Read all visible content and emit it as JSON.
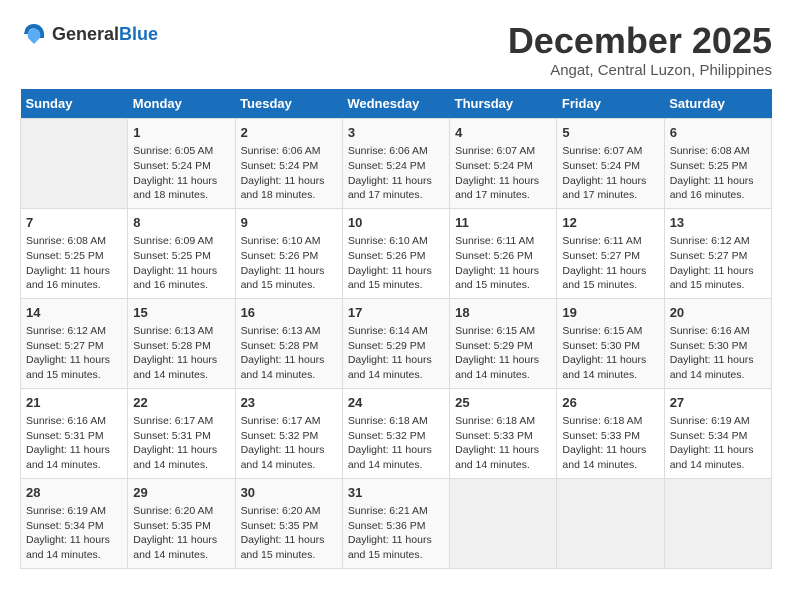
{
  "logo": {
    "general": "General",
    "blue": "Blue"
  },
  "title": "December 2025",
  "subtitle": "Angat, Central Luzon, Philippines",
  "days_header": [
    "Sunday",
    "Monday",
    "Tuesday",
    "Wednesday",
    "Thursday",
    "Friday",
    "Saturday"
  ],
  "weeks": [
    [
      {
        "num": "",
        "info": ""
      },
      {
        "num": "1",
        "info": "Sunrise: 6:05 AM\nSunset: 5:24 PM\nDaylight: 11 hours\nand 18 minutes."
      },
      {
        "num": "2",
        "info": "Sunrise: 6:06 AM\nSunset: 5:24 PM\nDaylight: 11 hours\nand 18 minutes."
      },
      {
        "num": "3",
        "info": "Sunrise: 6:06 AM\nSunset: 5:24 PM\nDaylight: 11 hours\nand 17 minutes."
      },
      {
        "num": "4",
        "info": "Sunrise: 6:07 AM\nSunset: 5:24 PM\nDaylight: 11 hours\nand 17 minutes."
      },
      {
        "num": "5",
        "info": "Sunrise: 6:07 AM\nSunset: 5:24 PM\nDaylight: 11 hours\nand 17 minutes."
      },
      {
        "num": "6",
        "info": "Sunrise: 6:08 AM\nSunset: 5:25 PM\nDaylight: 11 hours\nand 16 minutes."
      }
    ],
    [
      {
        "num": "7",
        "info": "Sunrise: 6:08 AM\nSunset: 5:25 PM\nDaylight: 11 hours\nand 16 minutes."
      },
      {
        "num": "8",
        "info": "Sunrise: 6:09 AM\nSunset: 5:25 PM\nDaylight: 11 hours\nand 16 minutes."
      },
      {
        "num": "9",
        "info": "Sunrise: 6:10 AM\nSunset: 5:26 PM\nDaylight: 11 hours\nand 15 minutes."
      },
      {
        "num": "10",
        "info": "Sunrise: 6:10 AM\nSunset: 5:26 PM\nDaylight: 11 hours\nand 15 minutes."
      },
      {
        "num": "11",
        "info": "Sunrise: 6:11 AM\nSunset: 5:26 PM\nDaylight: 11 hours\nand 15 minutes."
      },
      {
        "num": "12",
        "info": "Sunrise: 6:11 AM\nSunset: 5:27 PM\nDaylight: 11 hours\nand 15 minutes."
      },
      {
        "num": "13",
        "info": "Sunrise: 6:12 AM\nSunset: 5:27 PM\nDaylight: 11 hours\nand 15 minutes."
      }
    ],
    [
      {
        "num": "14",
        "info": "Sunrise: 6:12 AM\nSunset: 5:27 PM\nDaylight: 11 hours\nand 15 minutes."
      },
      {
        "num": "15",
        "info": "Sunrise: 6:13 AM\nSunset: 5:28 PM\nDaylight: 11 hours\nand 14 minutes."
      },
      {
        "num": "16",
        "info": "Sunrise: 6:13 AM\nSunset: 5:28 PM\nDaylight: 11 hours\nand 14 minutes."
      },
      {
        "num": "17",
        "info": "Sunrise: 6:14 AM\nSunset: 5:29 PM\nDaylight: 11 hours\nand 14 minutes."
      },
      {
        "num": "18",
        "info": "Sunrise: 6:15 AM\nSunset: 5:29 PM\nDaylight: 11 hours\nand 14 minutes."
      },
      {
        "num": "19",
        "info": "Sunrise: 6:15 AM\nSunset: 5:30 PM\nDaylight: 11 hours\nand 14 minutes."
      },
      {
        "num": "20",
        "info": "Sunrise: 6:16 AM\nSunset: 5:30 PM\nDaylight: 11 hours\nand 14 minutes."
      }
    ],
    [
      {
        "num": "21",
        "info": "Sunrise: 6:16 AM\nSunset: 5:31 PM\nDaylight: 11 hours\nand 14 minutes."
      },
      {
        "num": "22",
        "info": "Sunrise: 6:17 AM\nSunset: 5:31 PM\nDaylight: 11 hours\nand 14 minutes."
      },
      {
        "num": "23",
        "info": "Sunrise: 6:17 AM\nSunset: 5:32 PM\nDaylight: 11 hours\nand 14 minutes."
      },
      {
        "num": "24",
        "info": "Sunrise: 6:18 AM\nSunset: 5:32 PM\nDaylight: 11 hours\nand 14 minutes."
      },
      {
        "num": "25",
        "info": "Sunrise: 6:18 AM\nSunset: 5:33 PM\nDaylight: 11 hours\nand 14 minutes."
      },
      {
        "num": "26",
        "info": "Sunrise: 6:18 AM\nSunset: 5:33 PM\nDaylight: 11 hours\nand 14 minutes."
      },
      {
        "num": "27",
        "info": "Sunrise: 6:19 AM\nSunset: 5:34 PM\nDaylight: 11 hours\nand 14 minutes."
      }
    ],
    [
      {
        "num": "28",
        "info": "Sunrise: 6:19 AM\nSunset: 5:34 PM\nDaylight: 11 hours\nand 14 minutes."
      },
      {
        "num": "29",
        "info": "Sunrise: 6:20 AM\nSunset: 5:35 PM\nDaylight: 11 hours\nand 14 minutes."
      },
      {
        "num": "30",
        "info": "Sunrise: 6:20 AM\nSunset: 5:35 PM\nDaylight: 11 hours\nand 15 minutes."
      },
      {
        "num": "31",
        "info": "Sunrise: 6:21 AM\nSunset: 5:36 PM\nDaylight: 11 hours\nand 15 minutes."
      },
      {
        "num": "",
        "info": ""
      },
      {
        "num": "",
        "info": ""
      },
      {
        "num": "",
        "info": ""
      }
    ]
  ]
}
